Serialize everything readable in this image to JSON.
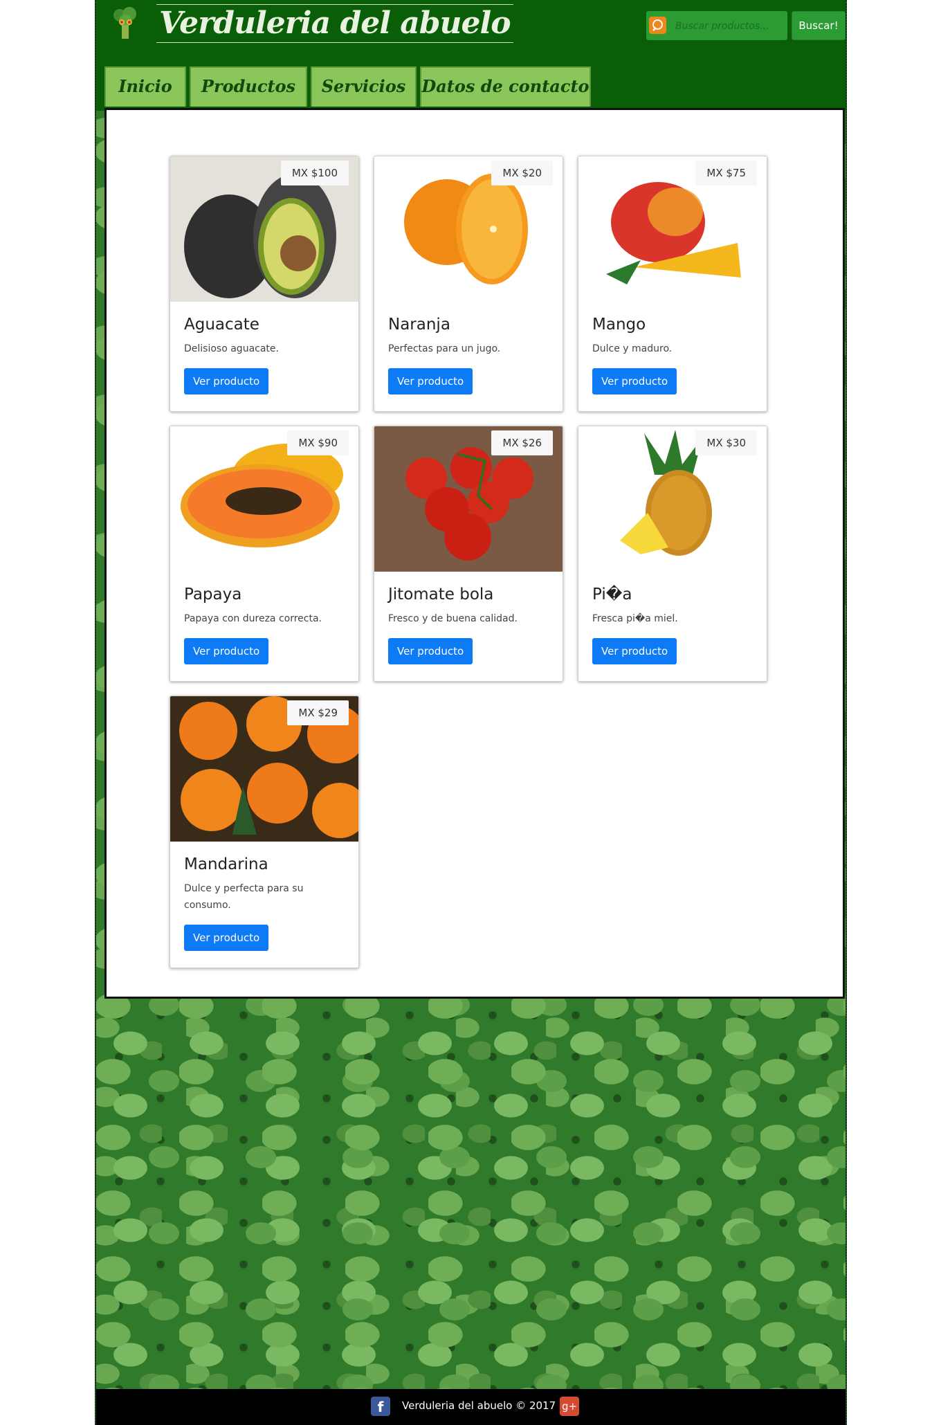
{
  "header": {
    "site_title": "Verduleria del abuelo",
    "search_placeholder": "Buscar productos...",
    "search_button": "Buscar!"
  },
  "nav": {
    "items": [
      {
        "label": "Inicio"
      },
      {
        "label": "Productos"
      },
      {
        "label": "Servicios"
      },
      {
        "label": "Datos de contacto"
      }
    ]
  },
  "products": [
    {
      "name": "Aguacate",
      "price": "MX $100",
      "description": "Delisioso aguacate.",
      "button": "Ver producto"
    },
    {
      "name": "Naranja",
      "price": "MX $20",
      "description": "Perfectas para un jugo.",
      "button": "Ver producto"
    },
    {
      "name": "Mango",
      "price": "MX $75",
      "description": "Dulce y maduro.",
      "button": "Ver producto"
    },
    {
      "name": "Papaya",
      "price": "MX $90",
      "description": "Papaya con dureza correcta.",
      "button": "Ver producto"
    },
    {
      "name": "Jitomate bola",
      "price": "MX $26",
      "description": "Fresco y de buena calidad.",
      "button": "Ver producto"
    },
    {
      "name": "Pi�a",
      "price": "MX $30",
      "description": "Fresca pi�a miel.",
      "button": "Ver producto"
    },
    {
      "name": "Mandarina",
      "price": "MX $29",
      "description": "Dulce y perfecta para su consumo.",
      "button": "Ver producto"
    }
  ],
  "footer": {
    "text": "Verduleria del abuelo © 2017"
  },
  "colors": {
    "header_bg": "#0b5e08",
    "nav_bg": "#8bc65b",
    "button_blue": "#0d7bf5",
    "search_green": "#2a9c33"
  }
}
